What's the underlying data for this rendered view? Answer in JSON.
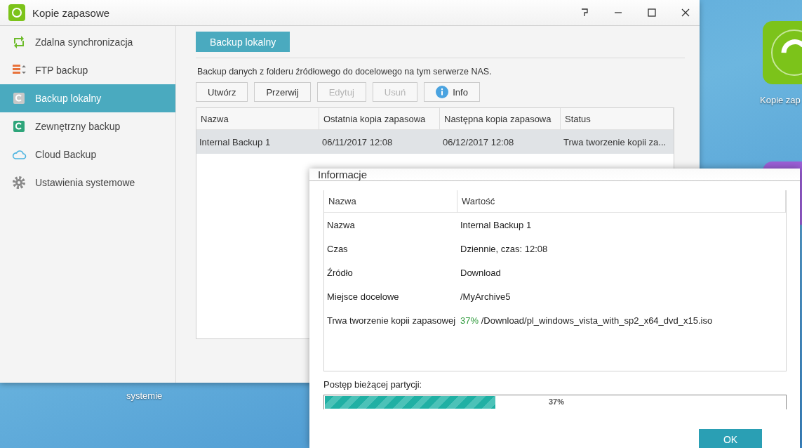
{
  "desktop": {
    "icons": [
      {
        "label": "Kopie zap",
        "kind": "app"
      },
      {
        "label": "systemie",
        "kind": "label"
      }
    ]
  },
  "window": {
    "title": "Kopie zapasowe"
  },
  "sidebar": {
    "items": [
      {
        "label": "Zdalna synchronizacja",
        "kind": "sync",
        "selected": false
      },
      {
        "label": "FTP backup",
        "kind": "ftp",
        "selected": false
      },
      {
        "label": "Backup lokalny",
        "kind": "local",
        "selected": true
      },
      {
        "label": "Zewnętrzny backup",
        "kind": "external",
        "selected": false
      },
      {
        "label": "Cloud Backup",
        "kind": "cloud",
        "selected": false
      },
      {
        "label": "Ustawienia systemowe",
        "kind": "settings",
        "selected": false
      }
    ]
  },
  "tabs": [
    {
      "label": "Backup lokalny",
      "selected": true
    }
  ],
  "description": "Backup danych z folderu źródłowego do docelowego na tym serwerze NAS.",
  "toolbar": [
    {
      "label": "Utwórz",
      "disabled": false,
      "kind": "plain"
    },
    {
      "label": "Przerwij",
      "disabled": false,
      "kind": "plain"
    },
    {
      "label": "Edytuj",
      "disabled": true,
      "kind": "plain"
    },
    {
      "label": "Usuń",
      "disabled": true,
      "kind": "plain"
    },
    {
      "label": "Info",
      "disabled": false,
      "kind": "info"
    }
  ],
  "table": {
    "columns": [
      "Nazwa",
      "Ostatnia kopia zapasowa",
      "Następna kopia zapasowa",
      "Status"
    ],
    "rows": [
      {
        "cells": [
          "Internal Backup 1",
          "06/11/2017 12:08",
          "06/12/2017 12:08",
          "Trwa tworzenie kopii za..."
        ],
        "selected": true
      }
    ]
  },
  "dialog": {
    "title": "Informacje",
    "columns": [
      "Nazwa",
      "Wartość"
    ],
    "rows": [
      {
        "name": "Nazwa",
        "value": "Internal Backup 1"
      },
      {
        "name": "Czas",
        "value": "Dziennie, czas: 12:08"
      },
      {
        "name": "Źródło",
        "value": "Download"
      },
      {
        "name": "Miejsce docelowe",
        "value": "/MyArchive5"
      },
      {
        "name": "Trwa tworzenie kopii zapasowej",
        "percent": "37%",
        "value": "/Download/pl_windows_vista_with_sp2_x64_dvd_x15.iso"
      }
    ],
    "progress_label": "Postęp bieżącej partycji:",
    "progress": {
      "level": 0.37,
      "reading": "37%"
    },
    "ok": "OK"
  }
}
